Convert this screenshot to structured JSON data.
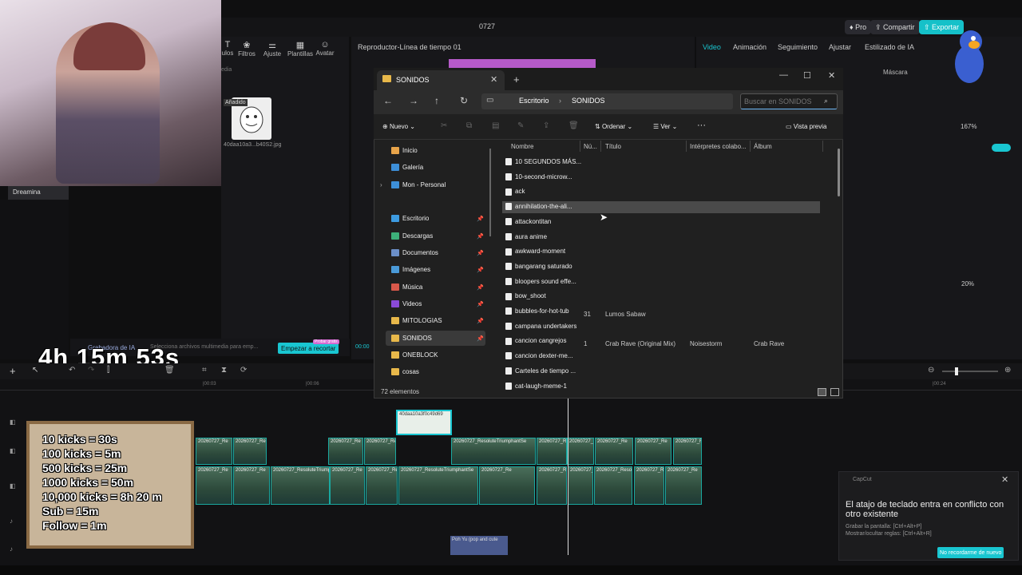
{
  "capcut": {
    "window_title": "0727",
    "pro_label": "Pro",
    "share_label": "Compartir",
    "export_label": "Exportar",
    "left_tools": [
      "ulos",
      "Filtros",
      "Ajuste",
      "Plantillas",
      "Avatar"
    ],
    "media_search": "edia",
    "added_badge": "Añadido",
    "media_thumb_name": "40daa10a3...b40S2.jpg",
    "dreamina_label": "Dreamina",
    "player_title": "Reproductor-Línea de tiempo 01",
    "right_tabs": [
      "Video",
      "Animación",
      "Seguimiento",
      "Ajustar",
      "Estilizado de IA"
    ],
    "mask_label": "Máscara",
    "zoom_value": "167%",
    "opacity_value": "20%",
    "ai_recorder_label": "Grabadora de IA",
    "ai_hint": "Selecciona archivos multimedia para emp...",
    "start_cut_label": "Empezar a recortar",
    "start_cut_badge": "Probar gratis",
    "time_code": "00:00",
    "ruler_ticks": [
      "|00:03",
      "|00:06",
      "|00:24"
    ],
    "image_clip_label": "40daa10a3f0c49d69",
    "clip_label_a": "20260727_Re",
    "clip_label_b": "20260727_ResoluteTriumphantSe",
    "clip_label_c": "20260727_Resolute",
    "audio_clip_label": "Poh Yu (pop and cute"
  },
  "stream": {
    "timer": "4h 15m 53s",
    "kicks": [
      "10 kicks = 30s",
      "100 kicks = 5m",
      "500 kicks = 25m",
      "1000 kicks = 50m",
      "10,000 kicks = 8h 20 m",
      "Sub = 15m",
      "Follow = 1m"
    ]
  },
  "explorer": {
    "tab_title": "SONIDOS",
    "breadcrumb": [
      "Escritorio",
      "SONIDOS"
    ],
    "search_placeholder": "Buscar en SONIDOS",
    "new_label": "Nuevo",
    "sort_label": "Ordenar",
    "view_label": "Ver",
    "preview_label": "Vista previa",
    "nav_items": [
      {
        "label": "Inicio",
        "color": "#e8a44a"
      },
      {
        "label": "Galería",
        "color": "#3d8fd8"
      },
      {
        "label": "Mon - Personal",
        "color": "#3d8fd8"
      },
      {
        "label": "Escritorio",
        "color": "#3d9be0"
      },
      {
        "label": "Descargas",
        "color": "#3db07a"
      },
      {
        "label": "Documentos",
        "color": "#6b8fc8"
      },
      {
        "label": "Imágenes",
        "color": "#4a9ad8"
      },
      {
        "label": "Música",
        "color": "#d8584a"
      },
      {
        "label": "Videos",
        "color": "#8a4ad8"
      },
      {
        "label": "MITOLOGIAS",
        "color": "#e8b84a"
      },
      {
        "label": "SONIDOS",
        "color": "#e8b84a"
      },
      {
        "label": "ONEBLOCK",
        "color": "#e8b84a"
      },
      {
        "label": "cosas",
        "color": "#e8b84a"
      }
    ],
    "columns": [
      "Nombre",
      "Nú...",
      "Título",
      "Intérpretes colabo...",
      "Álbum"
    ],
    "files": [
      {
        "name": "10 SEGUNDOS MÁS...",
        "num": "",
        "title": "",
        "artist": "",
        "album": ""
      },
      {
        "name": "10-second-microw...",
        "num": "",
        "title": "",
        "artist": "",
        "album": ""
      },
      {
        "name": "ack",
        "num": "",
        "title": "",
        "artist": "",
        "album": ""
      },
      {
        "name": "annihilation-the-ali...",
        "num": "",
        "title": "",
        "artist": "",
        "album": ""
      },
      {
        "name": "attackontitan",
        "num": "",
        "title": "",
        "artist": "",
        "album": ""
      },
      {
        "name": "aura anime",
        "num": "",
        "title": "",
        "artist": "",
        "album": ""
      },
      {
        "name": "awkward-moment",
        "num": "",
        "title": "",
        "artist": "",
        "album": ""
      },
      {
        "name": "bangarang saturado",
        "num": "",
        "title": "",
        "artist": "",
        "album": ""
      },
      {
        "name": "bloopers sound effe...",
        "num": "",
        "title": "",
        "artist": "",
        "album": ""
      },
      {
        "name": "bow_shoot",
        "num": "",
        "title": "",
        "artist": "",
        "album": ""
      },
      {
        "name": "bubbles-for-hot-tub",
        "num": "31",
        "title": "Lumos Sabaw",
        "artist": "",
        "album": ""
      },
      {
        "name": "campana undertakers",
        "num": "",
        "title": "",
        "artist": "",
        "album": ""
      },
      {
        "name": "cancion cangrejos",
        "num": "1",
        "title": "Crab Rave (Original Mix)",
        "artist": "Noisestorm",
        "album": "Crab Rave"
      },
      {
        "name": "cancion dexter-me...",
        "num": "",
        "title": "",
        "artist": "",
        "album": ""
      },
      {
        "name": "Carteles de tiempo ...",
        "num": "",
        "title": "",
        "artist": "",
        "album": ""
      },
      {
        "name": "cat-laugh-meme-1",
        "num": "",
        "title": "",
        "artist": "",
        "album": ""
      }
    ],
    "status": "72 elementos"
  },
  "toast": {
    "app": "CapCut",
    "message": "El atajo de teclado entra en conflicto con otro existente",
    "line1": "Grabar la pantalla: [Ctrl+Alt+P]",
    "line2": "Mostrar/ocultar reglas: [Ctrl+Alt+R]",
    "button": "No recordarme de nuevo"
  }
}
